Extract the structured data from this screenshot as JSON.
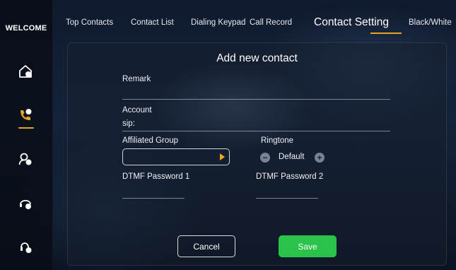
{
  "sidebar": {
    "welcome": "WELCOME"
  },
  "tabs": [
    {
      "label": "Top Contacts"
    },
    {
      "label": "Contact List"
    },
    {
      "label": "Dialing Keypad"
    },
    {
      "label": "Call Record"
    },
    {
      "label": "Contact Setting"
    },
    {
      "label": "Black/White"
    }
  ],
  "active_tab": "Contact Setting",
  "form": {
    "title": "Add new contact",
    "remark_label": "Remark",
    "remark_value": "",
    "account_label": "Account",
    "account_value": "sip:",
    "group_label": "Affiliated Group",
    "group_value": "",
    "ringtone_label": "Ringtone",
    "ringtone_value": "Default",
    "dtmf1_label": "DTMF Password 1",
    "dtmf1_value": "",
    "dtmf2_label": "DTMF Password 2",
    "dtmf2_value": "",
    "cancel_label": "Cancel",
    "save_label": "Save",
    "decrease_symbol": "−",
    "increase_symbol": "+"
  },
  "colors": {
    "accent": "#e8a320",
    "save": "#2bc24a"
  },
  "icons": [
    "home-icon",
    "phone-icon",
    "user-settings-icon",
    "headset-icon",
    "headset-settings-icon",
    "chevron-right-icon",
    "minus-icon",
    "plus-icon"
  ]
}
